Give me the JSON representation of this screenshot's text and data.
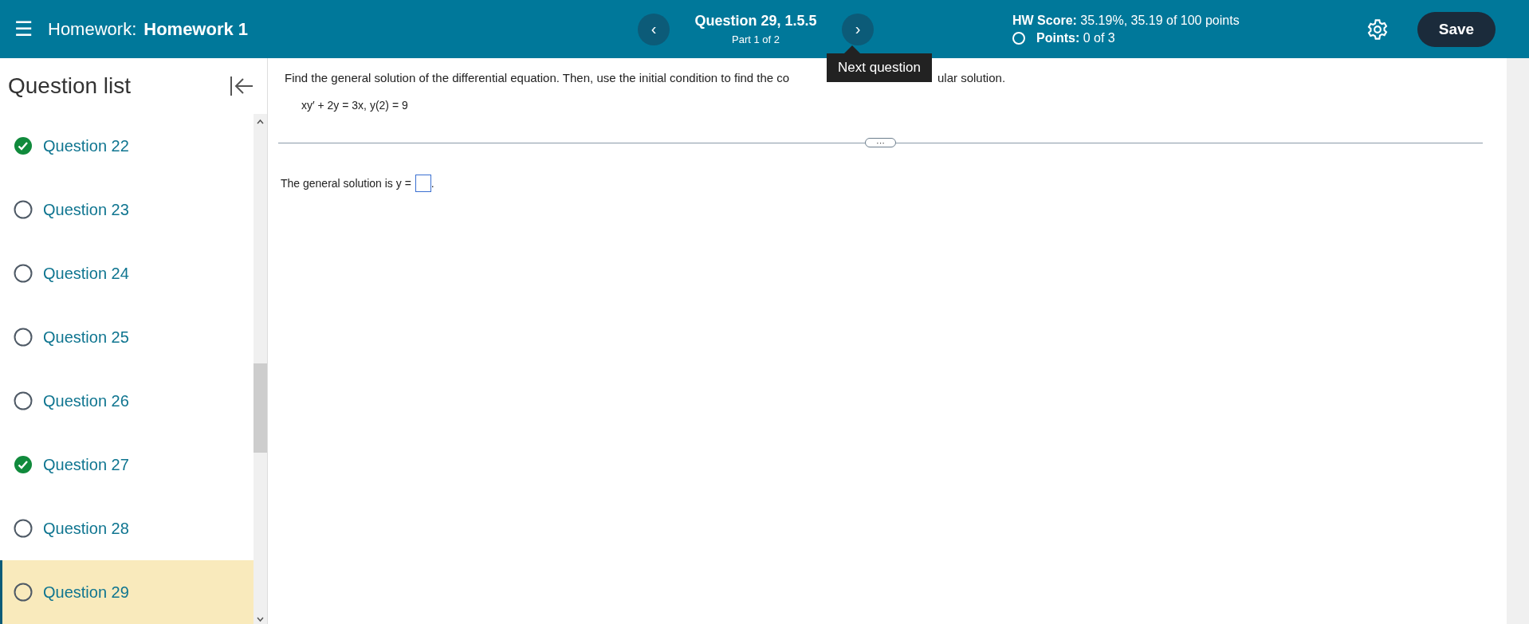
{
  "header": {
    "menu_label": "☰",
    "title_prefix": "Homework:",
    "title": "Homework 1",
    "question_title": "Question 29, 1.5.5",
    "question_part": "Part 1 of 2",
    "prev_label": "‹",
    "next_label": "›",
    "hw_score_label": "HW Score:",
    "hw_score_value": "35.19%, 35.19 of 100 points",
    "points_label": "Points:",
    "points_value": "0 of 3",
    "save_label": "Save"
  },
  "tooltip": {
    "text": "Next question"
  },
  "sidebar": {
    "title": "Question list",
    "items": [
      {
        "label": "Question 22",
        "completed": true,
        "selected": false
      },
      {
        "label": "Question 23",
        "completed": false,
        "selected": false
      },
      {
        "label": "Question 24",
        "completed": false,
        "selected": false
      },
      {
        "label": "Question 25",
        "completed": false,
        "selected": false
      },
      {
        "label": "Question 26",
        "completed": false,
        "selected": false
      },
      {
        "label": "Question 27",
        "completed": true,
        "selected": false
      },
      {
        "label": "Question 28",
        "completed": false,
        "selected": false
      },
      {
        "label": "Question 29",
        "completed": false,
        "selected": true
      }
    ]
  },
  "question": {
    "instruction_start": "Find the general solution of the differential equation. Then, use the initial condition to find the co",
    "instruction_end": "ular solution.",
    "equation": "xy′ + 2y = 3x, y(2) = 9",
    "more_label": "···",
    "answer_prompt": "The general solution is y =",
    "answer_end": "."
  }
}
